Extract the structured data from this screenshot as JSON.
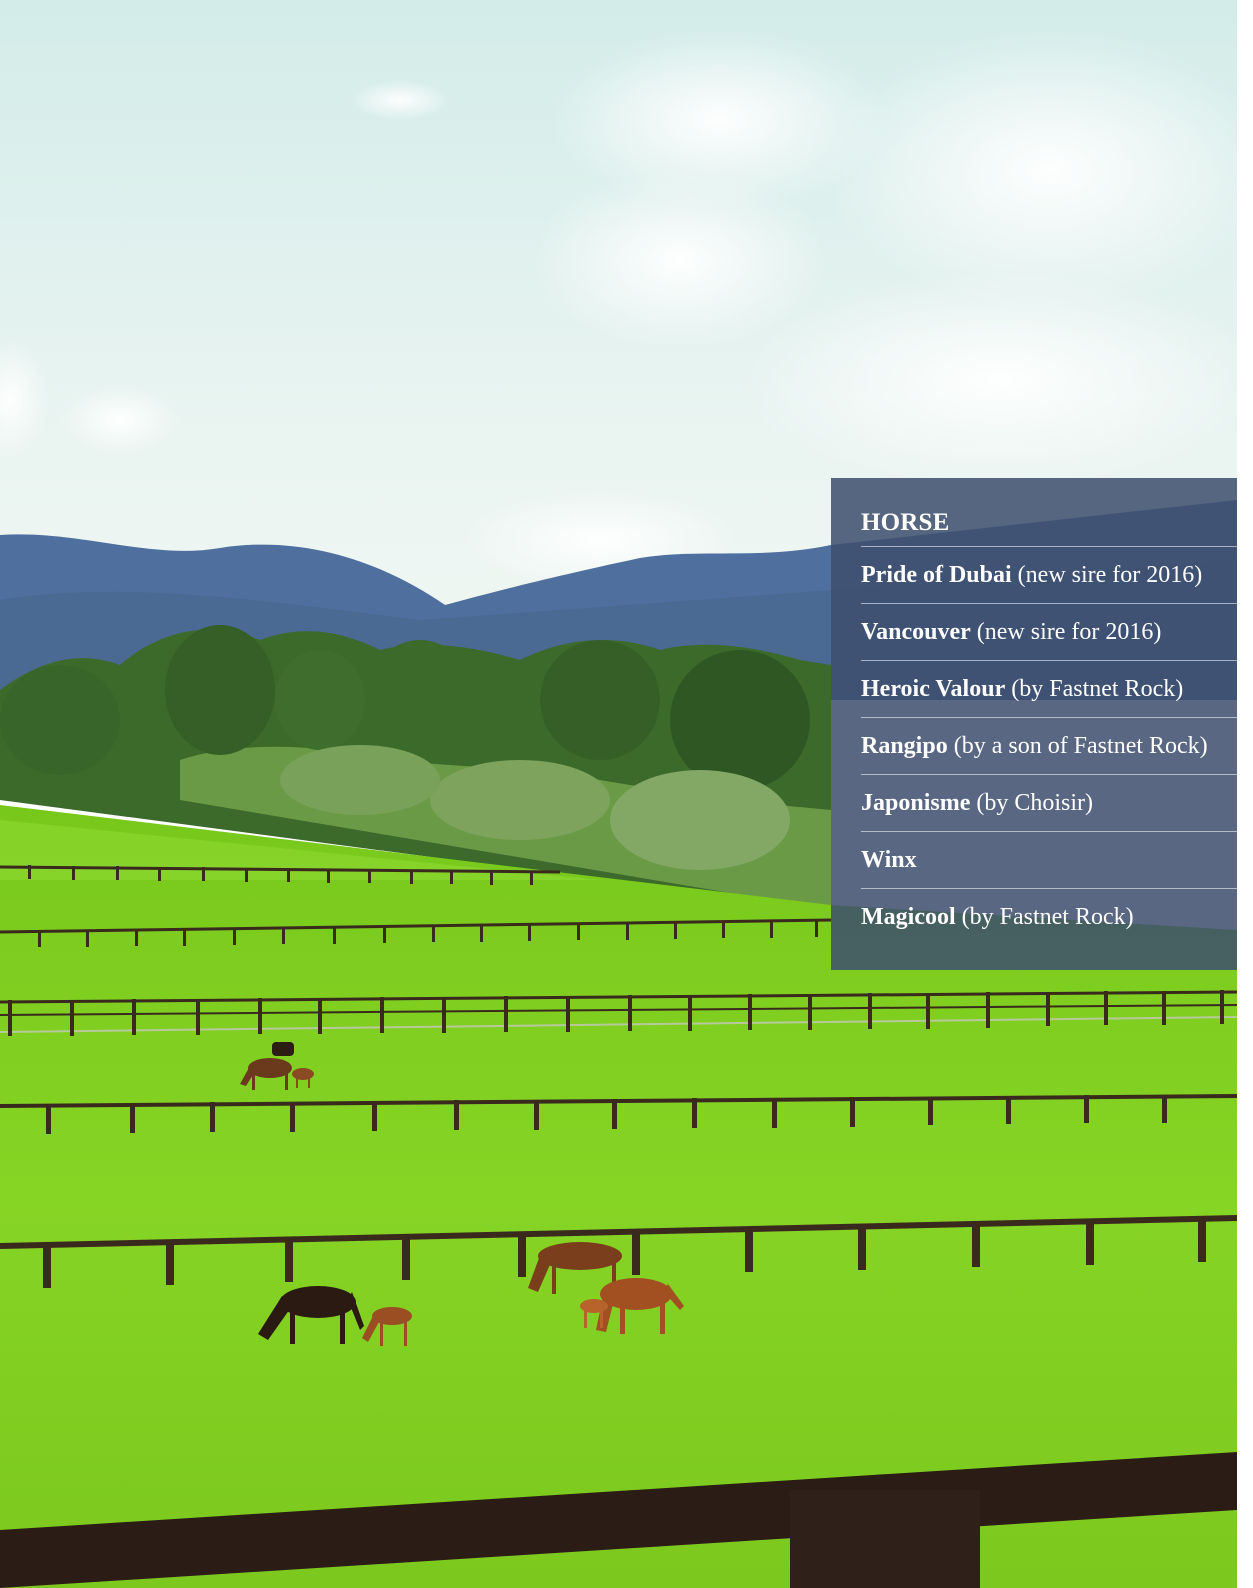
{
  "panel": {
    "header": "HORSE",
    "rows": [
      {
        "name": "Pride of Dubai",
        "note": "(new sire for 2016)"
      },
      {
        "name": "Vancouver",
        "note": "(new sire for 2016)"
      },
      {
        "name": "Heroic Valour",
        "note": "(by Fastnet Rock)"
      },
      {
        "name": "Rangipo",
        "note": "(by a son of Fastnet Rock)"
      },
      {
        "name": "Japonisme",
        "note": "(by Choisir)"
      },
      {
        "name": "Winx",
        "note": ""
      },
      {
        "name": "Magicool",
        "note": "(by Fastnet Rock)"
      }
    ]
  },
  "colors": {
    "sky_top": "#dcefee",
    "sky_bottom": "#eef6f2",
    "mountains": "#4c6a9a",
    "trees": "#3f6b2e",
    "grass": "#7fcd1d",
    "fence": "#3a2a1e",
    "panel_bg": "#3e4e6e"
  }
}
